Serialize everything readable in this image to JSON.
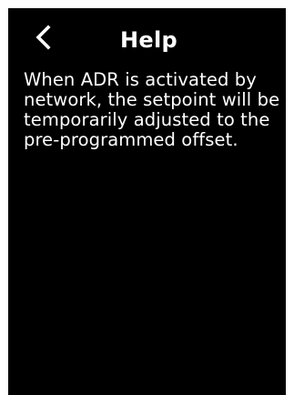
{
  "header": {
    "back_icon": "chevron-left-icon",
    "title": "Help"
  },
  "content": {
    "help_text": "When ADR is activated by network, the setpoint will be temporarily adjusted to the pre-programmed offset."
  },
  "colors": {
    "screen_background": "#000000",
    "text": "#ffffff",
    "bezel": "#ffffff"
  }
}
